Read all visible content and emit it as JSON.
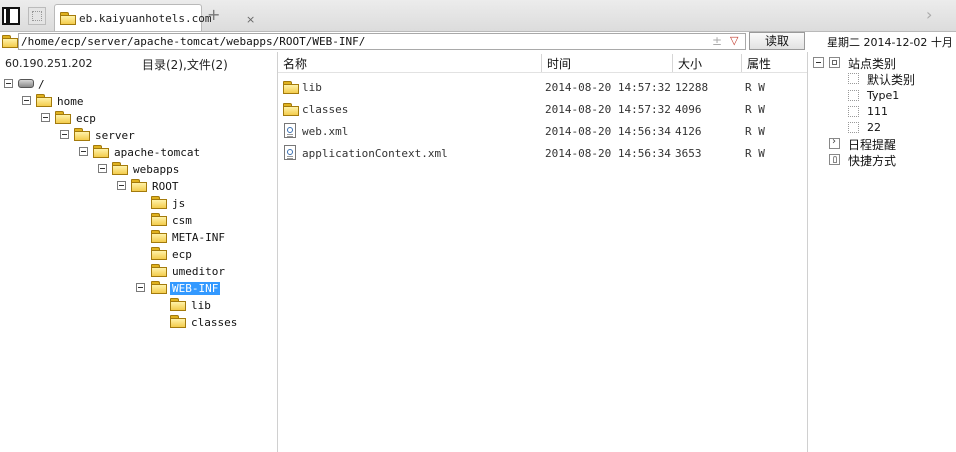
{
  "tab": {
    "title": "eb.kaiyuanhotels.com",
    "close": "×",
    "add": "+"
  },
  "address": {
    "path": "/home/ecp/server/apache-tomcat/webapps/ROOT/WEB-INF/",
    "read_button": "读取",
    "fav": "±",
    "drop": "▽"
  },
  "date_status": "星期二 2014-12-02 十月",
  "left_panel": {
    "ip": "60.190.251.202",
    "dir_count": "目录(2),文件(2)",
    "tree": [
      "/",
      "home",
      "ecp",
      "server",
      "apache-tomcat",
      "webapps",
      "ROOT",
      "js",
      "csm",
      "META-INF",
      "ecp",
      "umeditor",
      "WEB-INF",
      "lib",
      "classes"
    ]
  },
  "file_list": {
    "headers": {
      "name": "名称",
      "time": "时间",
      "size": "大小",
      "attr": "属性"
    },
    "rows": [
      {
        "type": "folder",
        "name": "lib",
        "time": "2014-08-20 14:57:32",
        "size": "12288",
        "attr": "R W"
      },
      {
        "type": "folder",
        "name": "classes",
        "time": "2014-08-20 14:57:32",
        "size": "4096",
        "attr": "R W"
      },
      {
        "type": "file",
        "name": "web.xml",
        "time": "2014-08-20 14:56:34",
        "size": "4126",
        "attr": "R W"
      },
      {
        "type": "file",
        "name": "applicationContext.xml",
        "time": "2014-08-20 14:56:34",
        "size": "3653",
        "attr": "R W"
      }
    ]
  },
  "right_panel": {
    "site_category": "站点类别",
    "categories": [
      "默认类别",
      "Type1",
      "111",
      "22"
    ],
    "schedule": "日程提醒",
    "shortcuts": "快捷方式"
  },
  "colors": {
    "selection": "#3399ff",
    "folder": "#f3cc4c"
  }
}
